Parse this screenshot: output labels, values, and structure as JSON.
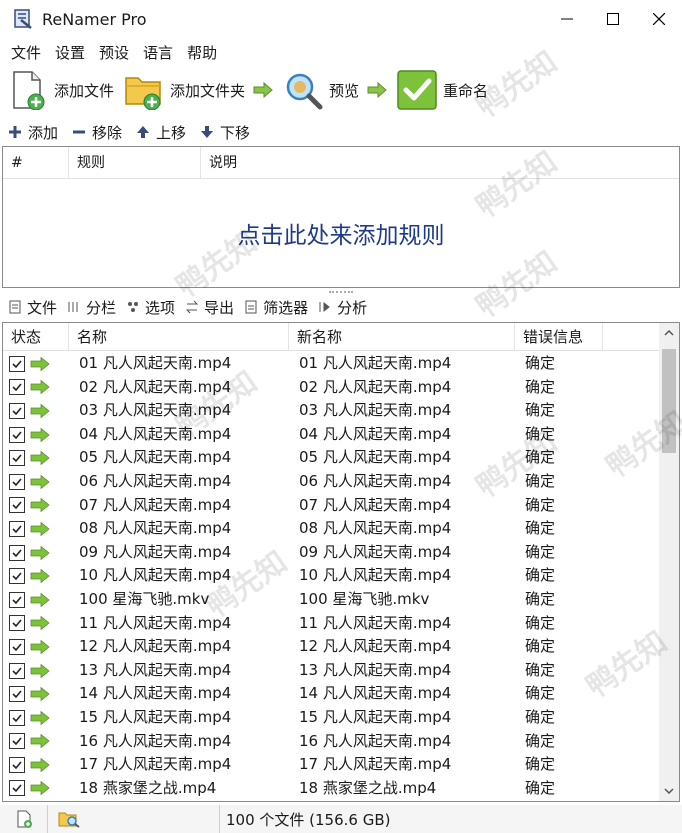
{
  "window": {
    "title": "ReNamer Pro"
  },
  "menu": [
    "文件",
    "设置",
    "预设",
    "语言",
    "帮助"
  ],
  "toolbar": {
    "add_files": "添加文件",
    "add_folder": "添加文件夹",
    "preview": "预览",
    "rename": "重命名"
  },
  "rules_toolbar": {
    "add": "添加",
    "remove": "移除",
    "up": "上移",
    "down": "下移"
  },
  "rules": {
    "headers": [
      "#",
      "规则",
      "说明"
    ],
    "empty_hint": "点击此处来添加规则"
  },
  "files_toolbar": [
    "文件",
    "分栏",
    "选项",
    "导出",
    "筛选器",
    "分析"
  ],
  "files": {
    "headers": [
      "状态",
      "名称",
      "新名称",
      "错误信息"
    ],
    "rows": [
      {
        "name": "01 凡人风起天南.mp4",
        "new_name": "01 凡人风起天南.mp4",
        "error": "确定"
      },
      {
        "name": "02 凡人风起天南.mp4",
        "new_name": "02 凡人风起天南.mp4",
        "error": "确定"
      },
      {
        "name": "03 凡人风起天南.mp4",
        "new_name": "03 凡人风起天南.mp4",
        "error": "确定"
      },
      {
        "name": "04 凡人风起天南.mp4",
        "new_name": "04 凡人风起天南.mp4",
        "error": "确定"
      },
      {
        "name": "05 凡人风起天南.mp4",
        "new_name": "05 凡人风起天南.mp4",
        "error": "确定"
      },
      {
        "name": "06 凡人风起天南.mp4",
        "new_name": "06 凡人风起天南.mp4",
        "error": "确定"
      },
      {
        "name": "07 凡人风起天南.mp4",
        "new_name": "07 凡人风起天南.mp4",
        "error": "确定"
      },
      {
        "name": "08 凡人风起天南.mp4",
        "new_name": "08 凡人风起天南.mp4",
        "error": "确定"
      },
      {
        "name": "09 凡人风起天南.mp4",
        "new_name": "09 凡人风起天南.mp4",
        "error": "确定"
      },
      {
        "name": "10 凡人风起天南.mp4",
        "new_name": "10 凡人风起天南.mp4",
        "error": "确定"
      },
      {
        "name": "100 星海飞驰.mkv",
        "new_name": "100 星海飞驰.mkv",
        "error": "确定"
      },
      {
        "name": "11 凡人风起天南.mp4",
        "new_name": "11 凡人风起天南.mp4",
        "error": "确定"
      },
      {
        "name": "12 凡人风起天南.mp4",
        "new_name": "12 凡人风起天南.mp4",
        "error": "确定"
      },
      {
        "name": "13 凡人风起天南.mp4",
        "new_name": "13 凡人风起天南.mp4",
        "error": "确定"
      },
      {
        "name": "14 凡人风起天南.mp4",
        "new_name": "14 凡人风起天南.mp4",
        "error": "确定"
      },
      {
        "name": "15 凡人风起天南.mp4",
        "new_name": "15 凡人风起天南.mp4",
        "error": "确定"
      },
      {
        "name": "16 凡人风起天南.mp4",
        "new_name": "16 凡人风起天南.mp4",
        "error": "确定"
      },
      {
        "name": "17 凡人风起天南.mp4",
        "new_name": "17 凡人风起天南.mp4",
        "error": "确定"
      },
      {
        "name": "18 燕家堡之战.mp4",
        "new_name": "18 燕家堡之战.mp4",
        "error": "确定"
      }
    ]
  },
  "status": {
    "summary": "100 个文件 (156.6 GB)"
  },
  "watermark": "鸭先知",
  "colors": {
    "accent_green": "#7cc23a",
    "hint_blue": "#1e3a8a"
  }
}
